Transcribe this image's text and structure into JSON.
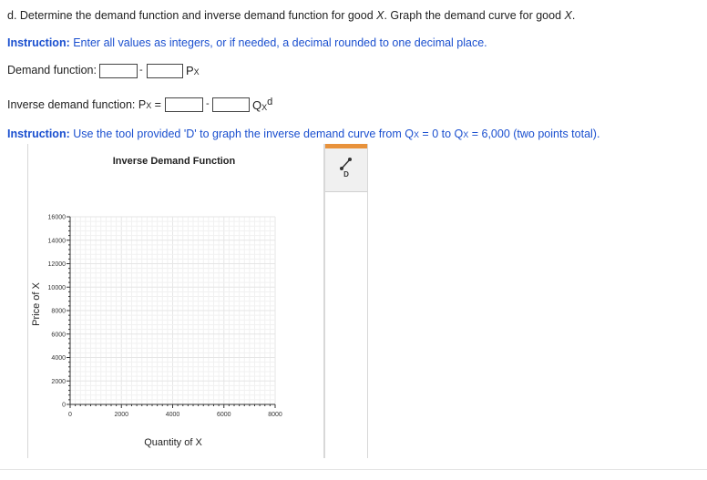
{
  "question": {
    "prefix": "d. Determine the demand function and inverse demand function for good ",
    "good": "X",
    "suffix": ". Graph the demand curve for good ",
    "good2": "X",
    "end": "."
  },
  "instruction1": {
    "label": "Instruction:",
    "text": " Enter all values as integers, or if needed, a decimal rounded to one decimal place."
  },
  "demand": {
    "label": "Demand function:",
    "minus": "-",
    "var": "P",
    "var_sub": "X"
  },
  "inverse": {
    "label": "Inverse demand function: P",
    "label_sub": "X",
    "equals": " =",
    "minus": "-",
    "var": "Q",
    "var_sub": "X",
    "var_sup": "d"
  },
  "instruction2": {
    "label": "Instruction:",
    "t1": " Use the tool provided 'D' to graph the inverse demand curve from Q",
    "s1": "X",
    "t2": " = 0 to Q",
    "s2": "X",
    "t3": " = 6,000 (two points total)."
  },
  "tool": {
    "label": "D",
    "icon": "line-tool-icon"
  },
  "chart_data": {
    "type": "line",
    "title": "Inverse Demand Function",
    "xlabel": "Quantity of X",
    "ylabel": "Price of X",
    "xlim": [
      0,
      8000
    ],
    "ylim": [
      0,
      16000
    ],
    "xticks": [
      0,
      2000,
      4000,
      6000,
      8000
    ],
    "yticks": [
      0,
      2000,
      4000,
      6000,
      8000,
      10000,
      12000,
      14000,
      16000
    ],
    "xtick_labels": [
      "0",
      "2000",
      "4000",
      "6000",
      "8000"
    ],
    "ytick_labels": [
      "0",
      "2000",
      "4000",
      "6000",
      "8000",
      "10000",
      "12000",
      "14000",
      "16000"
    ],
    "grid": true,
    "series": []
  }
}
